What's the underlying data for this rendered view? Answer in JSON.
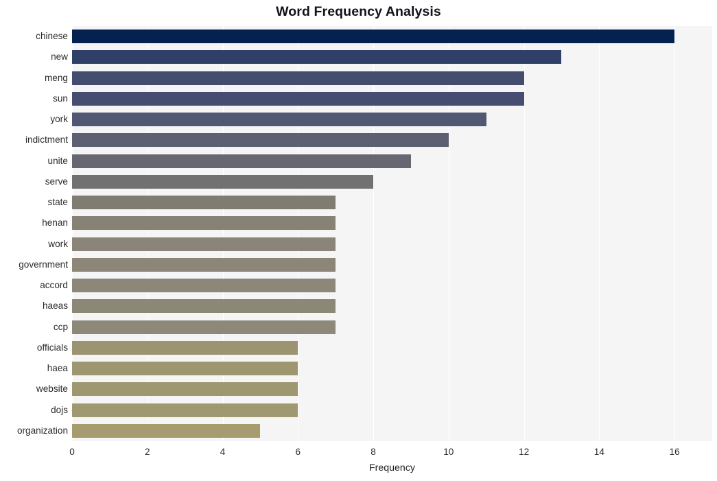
{
  "chart_data": {
    "type": "bar",
    "orientation": "horizontal",
    "title": "Word Frequency Analysis",
    "xlabel": "Frequency",
    "ylabel": "",
    "categories": [
      "chinese",
      "new",
      "meng",
      "sun",
      "york",
      "indictment",
      "unite",
      "serve",
      "state",
      "henan",
      "work",
      "government",
      "accord",
      "haeas",
      "ccp",
      "officials",
      "haea",
      "website",
      "dojs",
      "organization"
    ],
    "values": [
      16,
      13,
      12,
      12,
      11,
      10,
      9,
      8,
      7,
      7,
      7,
      7,
      7,
      7,
      7,
      6,
      6,
      6,
      6,
      5
    ],
    "xlim": [
      0,
      17
    ],
    "xticks": [
      0,
      2,
      4,
      6,
      8,
      10,
      12,
      14,
      16
    ],
    "xtick_labels": [
      "0",
      "2",
      "4",
      "6",
      "8",
      "10",
      "12",
      "14",
      "16"
    ],
    "grid": true,
    "grid_axis": "x",
    "legend": false,
    "bar_colors": [
      "#042250",
      "#2f3f68",
      "#444d6d",
      "#454e70",
      "#515873",
      "#5c6070",
      "#666771",
      "#727171",
      "#7f7d72",
      "#868376",
      "#8a8578",
      "#8b8678",
      "#8c8778",
      "#8c8878",
      "#8d8878",
      "#9c9470",
      "#9e9670",
      "#9f9770",
      "#a09870",
      "#a79c6f"
    ],
    "plot_background": "#f5f5f6",
    "figure_background": "#ffffff",
    "gridline_color": "#ffffff"
  }
}
